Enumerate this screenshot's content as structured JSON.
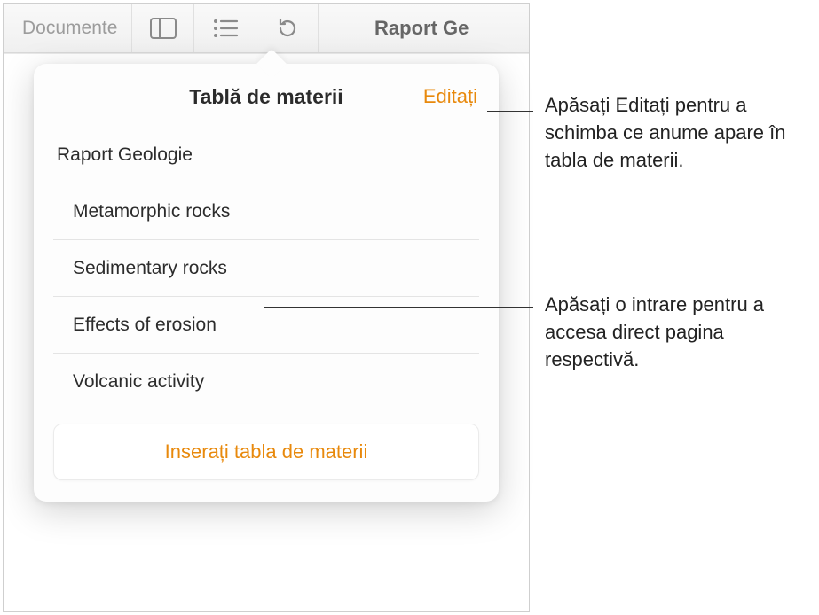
{
  "toolbar": {
    "documents_label": "Documente",
    "title": "Raport Ge"
  },
  "popover": {
    "title": "Tablă de materii",
    "edit_label": "Editați",
    "insert_label": "Inserați tabla de materii"
  },
  "toc": {
    "items": [
      {
        "label": "Raport Geologie",
        "level": 0
      },
      {
        "label": "Metamorphic rocks",
        "level": 1
      },
      {
        "label": "Sedimentary rocks",
        "level": 1
      },
      {
        "label": "Effects of erosion",
        "level": 1
      },
      {
        "label": "Volcanic activity",
        "level": 1
      }
    ]
  },
  "callouts": {
    "edit_hint": "Apăsați Editați pentru a schimba ce anume apare în tabla de materii.",
    "entry_hint": "Apăsați o intrare pentru a accesa direct pagina respectivă."
  },
  "colors": {
    "accent": "#e8890c"
  }
}
